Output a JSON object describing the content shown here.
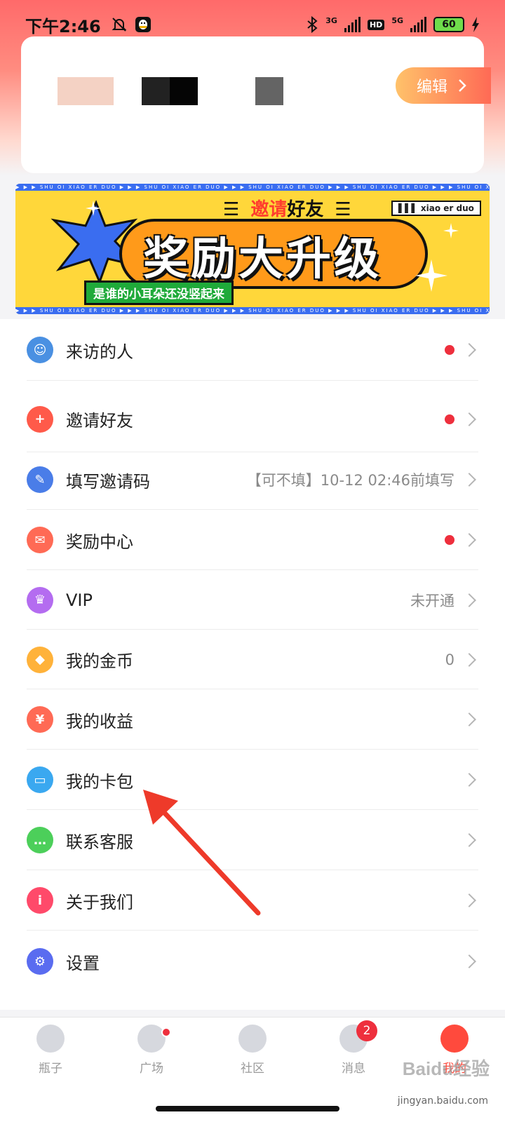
{
  "status_bar": {
    "time": "下午2:46",
    "network_1": "3G",
    "hd": "HD",
    "network_2": "5G",
    "battery": "60"
  },
  "profile": {
    "edit_label": "编辑"
  },
  "banner": {
    "invite_hl": "邀请",
    "invite_rest": "好友",
    "main": "奖励大升级",
    "sub": "是谁的小耳朵还没竖起来",
    "tag": "xiao er duo",
    "strip_text": "▶ ▶ ▶ SHU OI XIAO ER DUO   ▶ ▶ ▶ SHU OI XIAO ER DUO   ▶ ▶ ▶ SHU OI XIAO ER DUO   ▶ ▶ ▶ SHU OI XIAO ER DUO   ▶ ▶ ▶ SHU OI XIAO ER DUO   ▶ ▶ ▶ SHU OI XIAO ER DUO"
  },
  "menu": {
    "items": [
      {
        "label": "来访的人",
        "value": "",
        "dot": true,
        "icon": "visitor-icon",
        "color": "#4a90e2"
      },
      {
        "label": "邀请好友",
        "value": "",
        "dot": true,
        "icon": "add-friend-icon",
        "color": "#ff5a4a"
      },
      {
        "label": "填写邀请码",
        "value": "【可不填】10-12 02:46前填写",
        "dot": false,
        "icon": "invite-code-icon",
        "color": "#4a7de8"
      },
      {
        "label": "奖励中心",
        "value": "",
        "dot": true,
        "icon": "reward-icon",
        "color": "#ff6a55"
      },
      {
        "label": "VIP",
        "value": "未开通",
        "dot": false,
        "icon": "crown-icon",
        "color": "#b46cf0"
      },
      {
        "label": "我的金币",
        "value": "0",
        "dot": false,
        "icon": "coin-icon",
        "color": "#ffb23a"
      },
      {
        "label": "我的收益",
        "value": "",
        "dot": false,
        "icon": "money-bag-icon",
        "color": "#ff6a55"
      },
      {
        "label": "我的卡包",
        "value": "",
        "dot": false,
        "icon": "card-icon",
        "color": "#3aa8f0"
      },
      {
        "label": "联系客服",
        "value": "",
        "dot": false,
        "icon": "chat-icon",
        "color": "#4ccf5a"
      },
      {
        "label": "关于我们",
        "value": "",
        "dot": false,
        "icon": "info-icon",
        "color": "#ff4a6a"
      },
      {
        "label": "设置",
        "value": "",
        "dot": false,
        "icon": "gear-icon",
        "color": "#5a6cf0"
      }
    ]
  },
  "tabbar": {
    "tabs": [
      {
        "label": "瓶子",
        "icon": "bottle-icon"
      },
      {
        "label": "广场",
        "icon": "heartbeat-icon"
      },
      {
        "label": "社区",
        "icon": "planet-icon"
      },
      {
        "label": "消息",
        "icon": "message-icon",
        "badge": "2"
      },
      {
        "label": "我的",
        "icon": "profile-face-icon"
      }
    ]
  },
  "watermark": {
    "brand": "Baidu经验",
    "url": "jingyan.baidu.com"
  }
}
